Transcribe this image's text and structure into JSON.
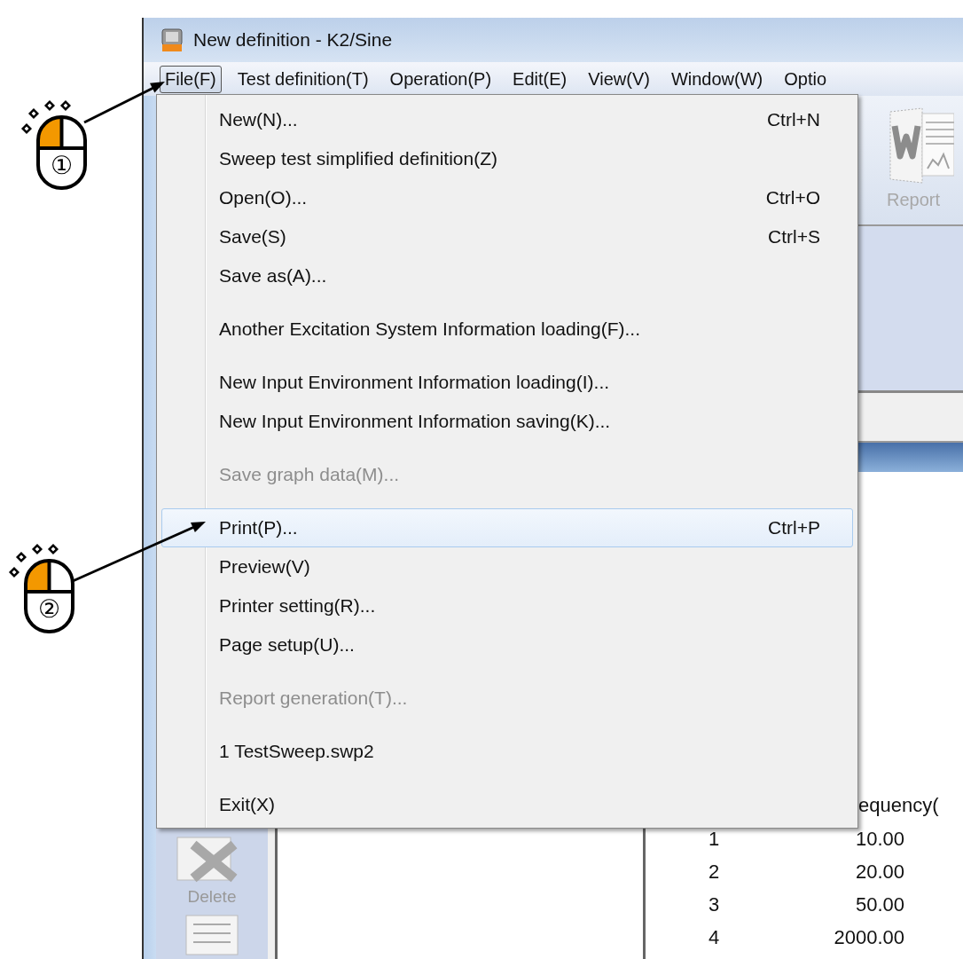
{
  "window": {
    "title": "New definition - K2/Sine"
  },
  "menu_bar": [
    {
      "label": "File(F)",
      "selected": true
    },
    {
      "label": "Test definition(T)",
      "selected": false
    },
    {
      "label": "Operation(P)",
      "selected": false
    },
    {
      "label": "Edit(E)",
      "selected": false
    },
    {
      "label": "View(V)",
      "selected": false
    },
    {
      "label": "Window(W)",
      "selected": false
    },
    {
      "label": "Optio",
      "selected": false
    }
  ],
  "toolbar": [
    {
      "label": "Report",
      "disabled": true
    }
  ],
  "file_menu": {
    "groups": [
      {
        "items": [
          {
            "label": "New(N)...",
            "shortcut": "Ctrl+N",
            "disabled": false,
            "selected": false
          },
          {
            "label": "Sweep test simplified definition(Z)",
            "disabled": false,
            "selected": false
          },
          {
            "label": "Open(O)...",
            "shortcut": "Ctrl+O",
            "disabled": false,
            "selected": false
          },
          {
            "label": "Save(S)",
            "shortcut": "Ctrl+S",
            "disabled": false,
            "selected": false
          },
          {
            "label": "Save as(A)...",
            "disabled": false,
            "selected": false
          }
        ]
      },
      {
        "items": [
          {
            "label": "Another Excitation System Information loading(F)...",
            "disabled": false,
            "selected": false
          }
        ]
      },
      {
        "items": [
          {
            "label": "New Input Environment Information loading(I)...",
            "disabled": false,
            "selected": false
          },
          {
            "label": "New Input Environment Information saving(K)...",
            "disabled": false,
            "selected": false
          }
        ]
      },
      {
        "items": [
          {
            "label": "Save graph data(M)...",
            "disabled": true,
            "selected": false
          }
        ]
      },
      {
        "items": [
          {
            "label": "Print(P)...",
            "shortcut": "Ctrl+P",
            "disabled": false,
            "selected": true
          },
          {
            "label": "Preview(V)",
            "disabled": false,
            "selected": false
          },
          {
            "label": "Printer setting(R)...",
            "disabled": false,
            "selected": false
          },
          {
            "label": "Page setup(U)...",
            "disabled": false,
            "selected": false
          }
        ]
      },
      {
        "items": [
          {
            "label": "Report generation(T)...",
            "disabled": true,
            "selected": false
          }
        ]
      },
      {
        "items": [
          {
            "label": "1 TestSweep.swp2",
            "disabled": false,
            "selected": false
          }
        ]
      },
      {
        "items": [
          {
            "label": "Exit(X)",
            "disabled": false,
            "selected": false
          }
        ]
      }
    ]
  },
  "sidebar": {
    "buttons": [
      {
        "label": "Delete",
        "disabled": true
      }
    ]
  },
  "table": {
    "header": "equency(",
    "rows": [
      {
        "cells": [
          "1",
          "10.00"
        ]
      },
      {
        "cells": [
          "2",
          "20.00"
        ]
      },
      {
        "cells": [
          "3",
          "50.00"
        ]
      },
      {
        "cells": [
          "4",
          "2000.00"
        ]
      }
    ]
  },
  "annotations": [
    {
      "number": "①"
    },
    {
      "number": "②"
    }
  ]
}
